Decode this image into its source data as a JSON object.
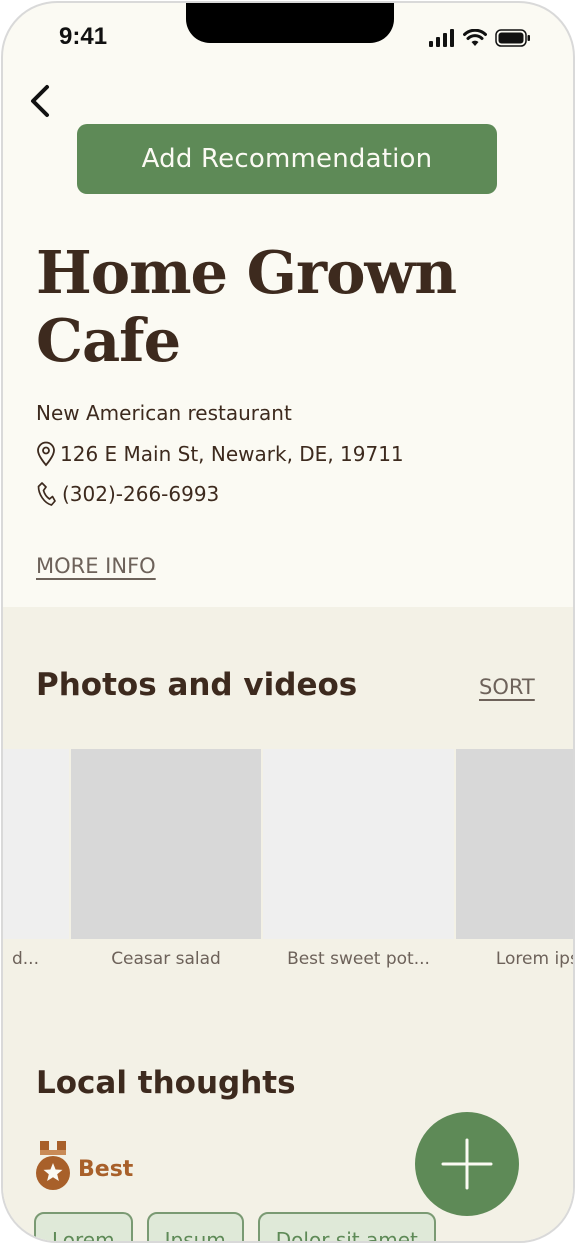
{
  "status_bar": {
    "time": "9:41"
  },
  "header": {
    "add_recommendation_label": "Add Recommendation"
  },
  "place": {
    "name": "Home Grown Cafe",
    "category": "New American restaurant",
    "address": "126 E Main St, Newark, DE, 19711",
    "phone": "(302)-266-6993",
    "more_info_label": "MORE INFO"
  },
  "photos": {
    "title": "Photos and videos",
    "sort_label": "SORT",
    "items": [
      {
        "caption": "d...",
        "color": "#efefef"
      },
      {
        "caption": "Ceasar salad",
        "color": "#d8d8d8"
      },
      {
        "caption": "Best sweet pot...",
        "color": "#efefef"
      },
      {
        "caption": "Lorem ipsum",
        "color": "#d8d8d8"
      }
    ]
  },
  "thoughts": {
    "title": "Local thoughts",
    "badge_label": "Best",
    "tags": [
      "Lorem",
      "Ipsum",
      "Dolor sit amet"
    ]
  },
  "colors": {
    "accent_green": "#5e8a57",
    "text_brown": "#3d2a1e",
    "badge_orange": "#a8602a",
    "background": "#fbfaf3",
    "section_background": "#f3f1e6"
  },
  "icons": {
    "back": "chevron-left-icon",
    "location": "map-pin-icon",
    "phone": "phone-icon",
    "badge": "medal-star-icon",
    "fab": "plus-icon"
  }
}
